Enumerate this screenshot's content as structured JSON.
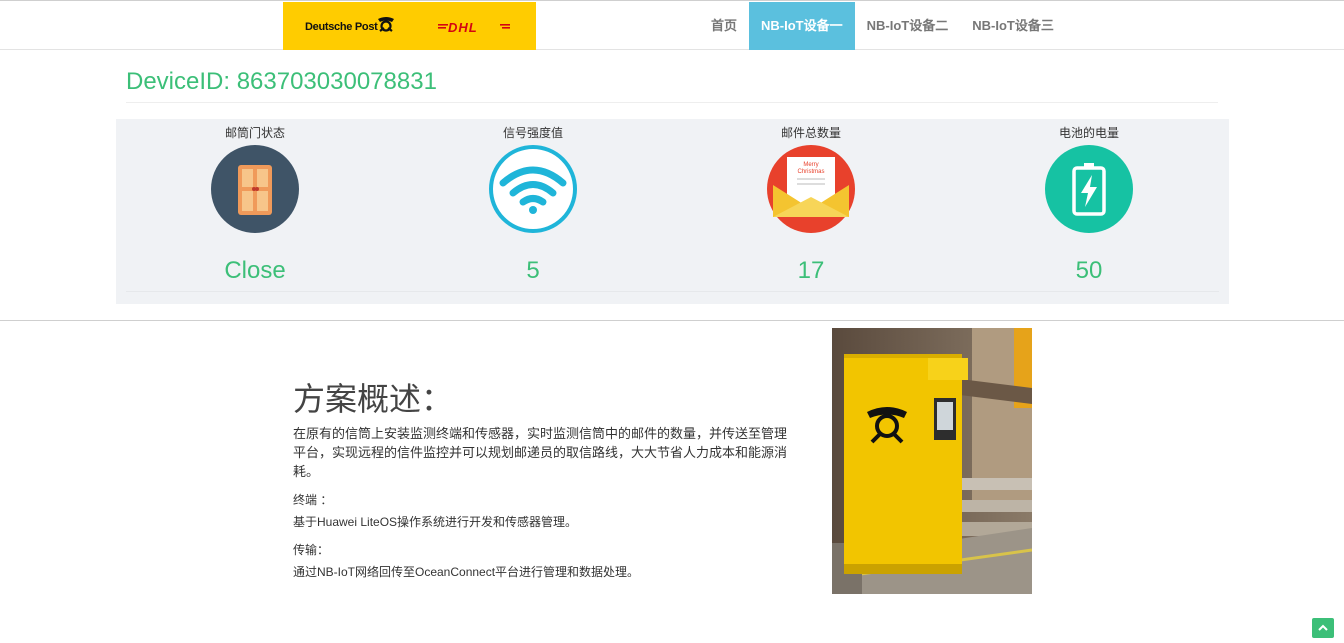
{
  "logo": {
    "deutsche_post": "Deutsche Post",
    "dhl": "DHL"
  },
  "nav": {
    "items": [
      {
        "label": "首页",
        "active": false
      },
      {
        "label": "NB-IoT设备一",
        "active": true
      },
      {
        "label": "NB-IoT设备二",
        "active": false
      },
      {
        "label": "NB-IoT设备三",
        "active": false
      }
    ]
  },
  "device": {
    "id_text": "DeviceID: 863703030078831"
  },
  "stats": [
    {
      "label": "邮筒门状态",
      "value": "Close",
      "icon": "door-icon"
    },
    {
      "label": "信号强度值",
      "value": "5",
      "icon": "wifi-signal-icon"
    },
    {
      "label": "邮件总数量",
      "value": "17",
      "icon": "mail-envelope-icon",
      "card_text": "Merry Christmas"
    },
    {
      "label": "电池的电量",
      "value": "50",
      "icon": "battery-icon"
    }
  ],
  "overview": {
    "title": "方案概述：",
    "description": "在原有的信筒上安装监测终端和传感器，实时监测信筒中的邮件的数量，并传送至管理平台，实现远程的信件监控并可以规划邮递员的取信路线，大大节省人力成本和能源消耗。",
    "terminal_label": "终端 ：",
    "terminal_text": "基于Huawei LiteOS操作系统进行开发和传感器管理。",
    "transport_label": "传输：",
    "transport_text": "通过NB-IoT网络回传至OceanConnect平台进行管理和数据处理。"
  },
  "colors": {
    "accent_green": "#3cbf78",
    "nav_active": "#5bc0de",
    "logo_yellow": "#ffcc00",
    "dhl_red": "#d40511"
  }
}
